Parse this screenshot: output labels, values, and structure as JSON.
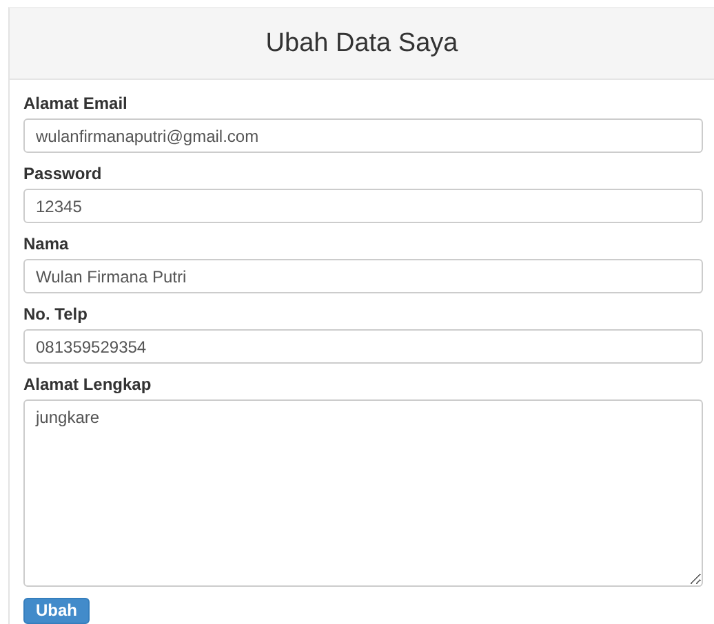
{
  "panel": {
    "title": "Ubah Data Saya"
  },
  "fields": [
    {
      "label": "Alamat Email",
      "kind": "input",
      "value": "wulanfirmanaputri@gmail.com"
    },
    {
      "label": "Password",
      "kind": "input",
      "value": "12345"
    },
    {
      "label": "Nama",
      "kind": "input",
      "value": "Wulan Firmana Putri"
    },
    {
      "label": "No. Telp",
      "kind": "input",
      "value": "081359529354"
    },
    {
      "label": "Alamat Lengkap",
      "kind": "textarea",
      "value": "jungkare"
    }
  ],
  "submit_button": "Ubah"
}
